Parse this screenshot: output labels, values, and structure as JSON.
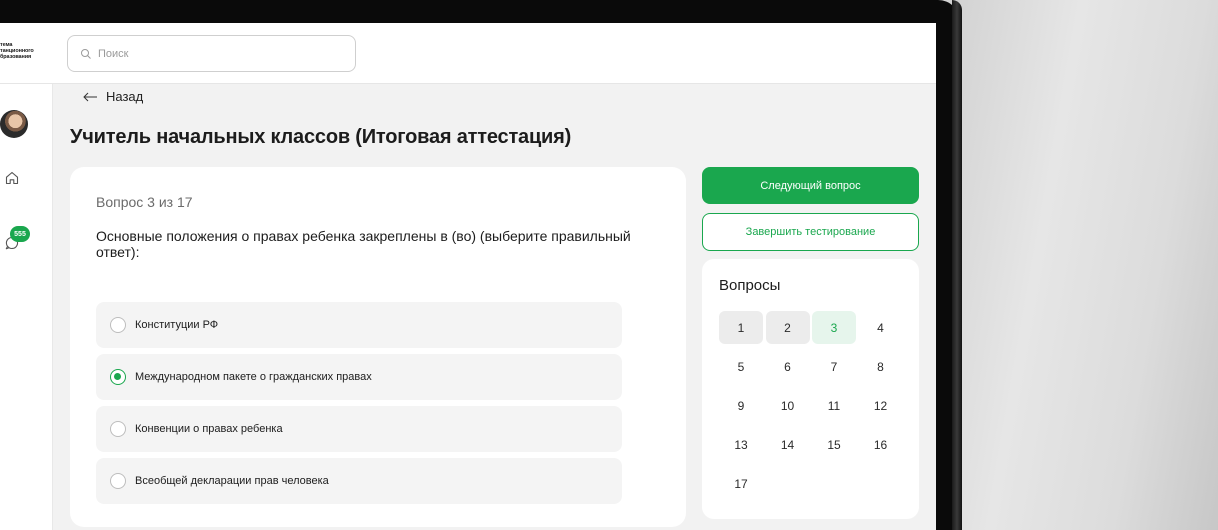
{
  "header": {
    "logo_lines": [
      "тема",
      "танционного",
      "бразования"
    ],
    "search_placeholder": "Поиск"
  },
  "sidebar": {
    "notification_count": "555"
  },
  "nav": {
    "back_label": "Назад"
  },
  "page": {
    "title": "Учитель начальных классов (Итоговая аттестация)"
  },
  "question": {
    "counter": "Вопрос 3 из 17",
    "text": "Основные положения о правах ребенка закреплены в (во) (выберите правильный ответ):",
    "options": [
      {
        "label": "Конституции РФ",
        "selected": false
      },
      {
        "label": "Международном пакете о гражданских правах",
        "selected": true
      },
      {
        "label": "Конвенции о правах ребенка",
        "selected": false
      },
      {
        "label": "Всеобщей декларации прав человека",
        "selected": false
      }
    ]
  },
  "actions": {
    "next_label": "Следующий вопрос",
    "finish_label": "Завершить тестирование"
  },
  "questions_panel": {
    "title": "Вопросы",
    "items": [
      {
        "label": "1",
        "state": "visited"
      },
      {
        "label": "2",
        "state": "visited"
      },
      {
        "label": "3",
        "state": "current"
      },
      {
        "label": "4",
        "state": "default"
      },
      {
        "label": "5",
        "state": "default"
      },
      {
        "label": "6",
        "state": "default"
      },
      {
        "label": "7",
        "state": "default"
      },
      {
        "label": "8",
        "state": "default"
      },
      {
        "label": "9",
        "state": "default"
      },
      {
        "label": "10",
        "state": "default"
      },
      {
        "label": "11",
        "state": "default"
      },
      {
        "label": "12",
        "state": "default"
      },
      {
        "label": "13",
        "state": "default"
      },
      {
        "label": "14",
        "state": "default"
      },
      {
        "label": "15",
        "state": "default"
      },
      {
        "label": "16",
        "state": "default"
      },
      {
        "label": "17",
        "state": "default"
      }
    ]
  },
  "colors": {
    "accent": "#1aa74e",
    "current_bg": "#e6f5ec",
    "visited_bg": "#ececec"
  }
}
